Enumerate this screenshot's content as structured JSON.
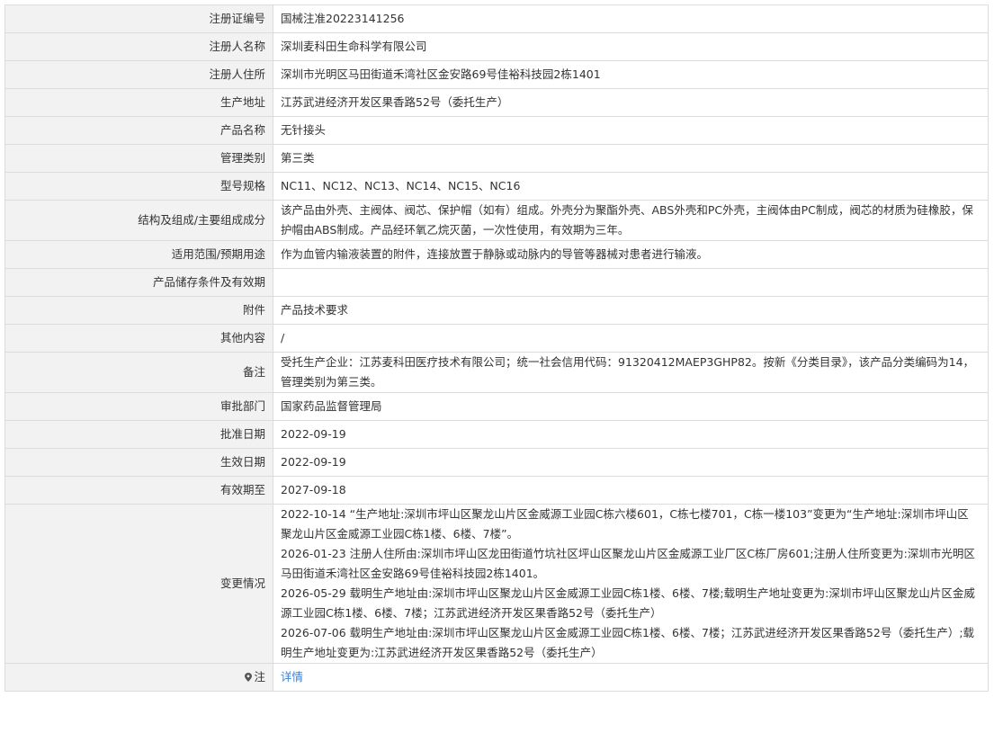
{
  "rows": [
    {
      "label": "注册证编号",
      "value": "国械注准20223141256"
    },
    {
      "label": "注册人名称",
      "value": "深圳麦科田生命科学有限公司"
    },
    {
      "label": "注册人住所",
      "value": "深圳市光明区马田街道禾湾社区金安路69号佳裕科技园2栋1401"
    },
    {
      "label": "生产地址",
      "value": "江苏武进经济开发区果香路52号（委托生产）"
    },
    {
      "label": "产品名称",
      "value": "无针接头"
    },
    {
      "label": "管理类别",
      "value": "第三类"
    },
    {
      "label": "型号规格",
      "value": "NC11、NC12、NC13、NC14、NC15、NC16"
    },
    {
      "label": "结构及组成/主要组成成分",
      "value": "该产品由外壳、主阀体、阀芯、保护帽（如有）组成。外壳分为聚酯外壳、ABS外壳和PC外壳，主阀体由PC制成，阀芯的材质为硅橡胶，保护帽由ABS制成。产品经环氧乙烷灭菌，一次性使用，有效期为三年。"
    },
    {
      "label": "适用范围/预期用途",
      "value": "作为血管内输液装置的附件，连接放置于静脉或动脉内的导管等器械对患者进行输液。"
    },
    {
      "label": "产品储存条件及有效期",
      "value": ""
    },
    {
      "label": "附件",
      "value": "产品技术要求"
    },
    {
      "label": "其他内容",
      "value": "/"
    },
    {
      "label": "备注",
      "value": "受托生产企业：江苏麦科田医疗技术有限公司；统一社会信用代码：91320412MAEP3GHP82。按新《分类目录》，该产品分类编码为14，管理类别为第三类。"
    },
    {
      "label": "审批部门",
      "value": "国家药品监督管理局"
    },
    {
      "label": "批准日期",
      "value": "2022-09-19"
    },
    {
      "label": "生效日期",
      "value": "2022-09-19"
    },
    {
      "label": "有效期至",
      "value": "2027-09-18"
    }
  ],
  "changes": {
    "label": "变更情况",
    "entries": [
      "2022-10-14 “生产地址:深圳市坪山区聚龙山片区金威源工业园C栋六楼601，C栋七楼701，C栋一楼103”变更为“生产地址:深圳市坪山区聚龙山片区金威源工业园C栋1楼、6楼、7楼”。",
      "2026-01-23 注册人住所由:深圳市坪山区龙田街道竹坑社区坪山区聚龙山片区金威源工业厂区C栋厂房601;注册人住所变更为:深圳市光明区马田街道禾湾社区金安路69号佳裕科技园2栋1401。",
      "2026-05-29 载明生产地址由:深圳市坪山区聚龙山片区金威源工业园C栋1楼、6楼、7楼;载明生产地址变更为:深圳市坪山区聚龙山片区金威源工业园C栋1楼、6楼、7楼；江苏武进经济开发区果香路52号（委托生产）",
      "2026-07-06 载明生产地址由:深圳市坪山区聚龙山片区金威源工业园C栋1楼、6楼、7楼；江苏武进经济开发区果香路52号（委托生产）;载明生产地址变更为:江苏武进经济开发区果香路52号（委托生产）"
    ]
  },
  "note": {
    "label": "注",
    "icon": "map-pin-icon",
    "link_text": "详情",
    "link_color": "#3a7fd5"
  }
}
